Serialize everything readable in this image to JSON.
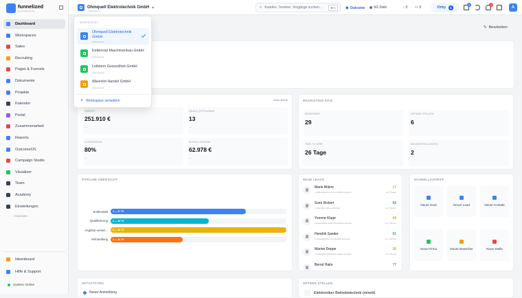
{
  "brand": {
    "name": "funnelized",
    "tagline": "by funnelized.com"
  },
  "sidebar": {
    "items": [
      {
        "label": "Dashboard",
        "icon": "grid-icon",
        "color": "#3b82f6"
      },
      {
        "label": "Workspaces",
        "icon": "workspace-icon",
        "color": "#3b82f6"
      },
      {
        "label": "Sales",
        "icon": "sales-icon",
        "color": "#ef4444"
      },
      {
        "label": "Recruiting",
        "icon": "recruiting-icon",
        "color": "#f59e0b"
      },
      {
        "label": "Pages & Funnels",
        "icon": "pages-icon",
        "color": "#ef4444"
      },
      {
        "label": "Dokumente",
        "icon": "document-icon",
        "color": "#3b82f6"
      },
      {
        "label": "Projekte",
        "icon": "project-icon",
        "color": "#3b82f6"
      },
      {
        "label": "Kalender",
        "icon": "calendar-icon",
        "color": "#374151"
      },
      {
        "label": "Portal",
        "icon": "portal-icon",
        "color": "#8b5cf6"
      },
      {
        "label": "Zusammenarbeit",
        "icon": "collaboration-icon",
        "color": "#ef4444"
      },
      {
        "label": "Reports",
        "icon": "reports-icon",
        "color": "#3b82f6"
      },
      {
        "label": "OutcomeOS",
        "icon": "outcome-icon",
        "color": "#3b82f6"
      },
      {
        "label": "Campaign Studio",
        "icon": "campaign-icon",
        "color": "#ef4444"
      },
      {
        "label": "Visualizer",
        "icon": "visualizer-icon",
        "color": "#22c55e"
      },
      {
        "label": "Team",
        "icon": "team-icon",
        "color": "#374151"
      },
      {
        "label": "Academy",
        "icon": "academy-icon",
        "color": "#374151"
      },
      {
        "label": "Einstellungen",
        "icon": "settings-icon",
        "color": "#374151"
      }
    ],
    "more": "Anpassen",
    "ideas": "Ideenboard",
    "help": "Hilfe & Support",
    "status": "System Online"
  },
  "topbar": {
    "workspace": "Ohmquell Elektrotechnik GmbH",
    "workspace_sub": "Unternehmen",
    "search_placeholder": "Kunden, Termine, Vorgänge suchen...",
    "search_kbd": "⌘ K",
    "outcome": "Outcome",
    "goals": "0/2 Ziele",
    "tasks": "0",
    "people": "0",
    "orby": "Orby",
    "orby_count": "1",
    "badge_blue": "3",
    "badge_red": "3",
    "avatar": "A"
  },
  "dropdown": {
    "heading": "WORKSPACES",
    "items": [
      {
        "name": "Ohmquell Elektrotechnik GmbH",
        "sub": "Unternehmen",
        "color": "#3b82f6",
        "selected": true
      },
      {
        "name": "Kettenrad Maschinenbau GmbH",
        "sub": "Unternehmen",
        "color": "#22c55e"
      },
      {
        "name": "Leitstern Gesundheit GmbH",
        "sub": "Unternehmen",
        "color": "#22c55e"
      },
      {
        "name": "Warenlot Handel GmbH",
        "sub": "Unternehmen",
        "color": "#f59e0b"
      }
    ],
    "manage": "Workspace verwalten"
  },
  "header": {
    "edit": "Bearbeiten"
  },
  "sales_kpis": {
    "more": "Alles Werte",
    "items": [
      {
        "label": "UMSATZ",
        "value": "251.910 €",
        "sub": "—"
      },
      {
        "label": "DEALS (OFFEN/WIN)",
        "value": "13",
        "sub": "—"
      },
      {
        "label": "CONVERSION",
        "value": "80%",
        "sub": "—"
      },
      {
        "label": "Ø DEAL-GRÖSSE",
        "value": "62.978 €",
        "sub": "—"
      }
    ]
  },
  "recruiting_kpis": {
    "title": "RECRUITING KPIS",
    "items": [
      {
        "label": "BEWERBER",
        "value": "29",
        "sub": "—"
      },
      {
        "label": "OFFENE STELLEN",
        "value": "6",
        "sub": "—"
      },
      {
        "label": "TIME-TO-HIRE",
        "value": "26 Tage",
        "sub": "—"
      },
      {
        "label": "NEUEINSTELLUNGEN",
        "value": "2",
        "sub": "—"
      }
    ]
  },
  "pipeline": {
    "title": "PIPELINE-ÜBERSICHT",
    "stages": [
      {
        "label": "Erstkontakt",
        "text": "3 — 67 T€",
        "fraction": 0.77,
        "color": "#3b82f6"
      },
      {
        "label": "Qualifizierung",
        "text": "2 — 48 T€",
        "fraction": 0.56,
        "color": "#06b6d4"
      },
      {
        "label": "Angebot versen...",
        "text": "5 — 92 T€",
        "fraction": 1.0,
        "color": "#eab308"
      },
      {
        "label": "Verhandlung",
        "text": "3 — 45 T€",
        "fraction": 0.41,
        "color": "#f97316"
      }
    ]
  },
  "leads": {
    "title": "NEUE LEADS",
    "items": [
      {
        "name": "Marie Ahlers",
        "email": "m.ahlers@sternfeld-immobilien.example",
        "score": "17",
        "time": "vor 4 Tagen",
        "color": "#f59e0b"
      },
      {
        "name": "Sven Rickert",
        "email": "s.rickert@nordbau.example",
        "score": "88",
        "time": "vor 1 Woche",
        "color": "#22c55e"
      },
      {
        "name": "Yvonne Kluge",
        "email": "y.kluge@lahnmedic-gesundheit.example",
        "score": "64",
        "time": "vor 1 Woche",
        "color": "#f59e0b"
      },
      {
        "name": "Hendrik Sander",
        "email": "h.sander@elbstrom-spedition.example",
        "score": "91",
        "time": "vor 1 Woche",
        "color": "#22c55e"
      },
      {
        "name": "Marion Deppe",
        "email": "m.deppe@engelsgarten-pflege.example",
        "score": "55",
        "time": "vor 1 Monat",
        "color": "#f59e0b"
      },
      {
        "name": "Bernd Halm",
        "email": "",
        "score": "77",
        "time": "",
        "color": "#22c55e"
      }
    ]
  },
  "quick": {
    "title": "SCHNELLZUGRIFF",
    "items": [
      {
        "label": "Neuer Deal",
        "icon": "deal-icon",
        "color": "#3b82f6"
      },
      {
        "label": "Neuer Lead",
        "icon": "lead-icon",
        "color": "#3b82f6"
      },
      {
        "label": "Neuer Kontakt",
        "icon": "contact-icon",
        "color": "#3b82f6"
      },
      {
        "label": "Neue Firma",
        "icon": "company-icon",
        "color": "#22c55e"
      },
      {
        "label": "Neuer Bewerber",
        "icon": "applicant-icon",
        "color": "#f59e0b"
      },
      {
        "label": "Neue Stelle",
        "icon": "job-icon",
        "color": "#ef4444"
      }
    ]
  },
  "activities": {
    "title": "AKTIVITÄTEN",
    "first": "Neuer Anmeldung"
  },
  "jobs": {
    "title": "OFFENE STELLEN",
    "first": "Elektroniker Betriebstechnik (m/w/d)"
  }
}
